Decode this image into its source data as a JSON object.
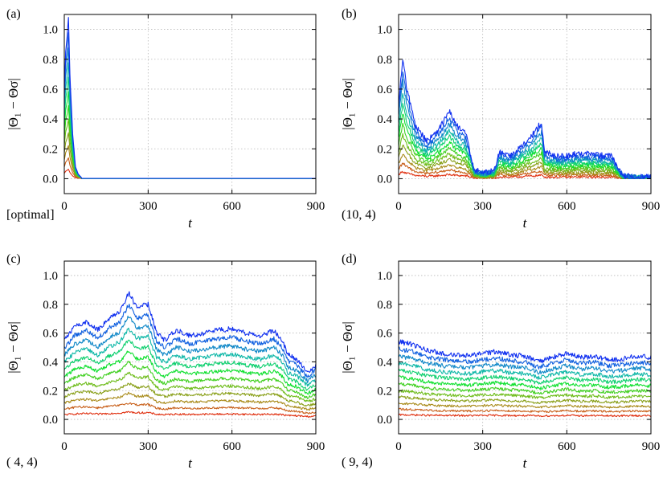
{
  "chart_data": [
    {
      "type": "line",
      "panel_label": "(a)",
      "corner_label": "[optimal]",
      "xlabel": "t",
      "ylabel": "|Θ₁ − Θσ|",
      "xlim": [
        0,
        900
      ],
      "ylim": [
        -0.1,
        1.1
      ],
      "xticks": [
        "0",
        "300",
        "600",
        "900"
      ],
      "yticks": [
        "0.0",
        "0.2",
        "0.4",
        "0.6",
        "0.8",
        "1.0"
      ],
      "grid": true,
      "n_series": 12,
      "series_colors": [
        "#e03010",
        "#c8601a",
        "#a88a18",
        "#8aa01a",
        "#6ebc1a",
        "#40d020",
        "#10e030",
        "#10d070",
        "#10b8a8",
        "#1088c8",
        "#1060e0",
        "#1030f0"
      ],
      "series": [
        {
          "x": [
            0,
            5,
            10,
            15,
            20,
            30,
            40,
            50,
            60,
            80,
            100,
            900
          ],
          "values": [
            0.6,
            0.85,
            0.95,
            1.08,
            0.7,
            0.3,
            0.08,
            0.03,
            0.01,
            0.003,
            0.0,
            0.0
          ]
        }
      ]
    },
    {
      "type": "line",
      "panel_label": "(b)",
      "corner_label": "(10, 4)",
      "xlabel": "t",
      "ylabel": "|Θ₁ − Θσ|",
      "xlim": [
        0,
        900
      ],
      "ylim": [
        -0.1,
        1.1
      ],
      "xticks": [
        "0",
        "300",
        "600",
        "900"
      ],
      "yticks": [
        "0.0",
        "0.2",
        "0.4",
        "0.6",
        "0.8",
        "1.0"
      ],
      "grid": true,
      "n_series": 12,
      "series_colors": [
        "#e03010",
        "#c8601a",
        "#a88a18",
        "#8aa01a",
        "#6ebc1a",
        "#40d020",
        "#10e030",
        "#10d070",
        "#10b8a8",
        "#1088c8",
        "#1060e0",
        "#1030f0"
      ],
      "series": [
        {
          "x": [
            0,
            15,
            30,
            60,
            100,
            130,
            160,
            180,
            210,
            240,
            270,
            300,
            340,
            360,
            400,
            440,
            480,
            510,
            520,
            560,
            600,
            650,
            700,
            760,
            780,
            800,
            850,
            900
          ],
          "values": [
            0.5,
            0.8,
            0.6,
            0.35,
            0.25,
            0.3,
            0.38,
            0.45,
            0.35,
            0.3,
            0.06,
            0.04,
            0.05,
            0.18,
            0.15,
            0.22,
            0.3,
            0.38,
            0.18,
            0.15,
            0.15,
            0.17,
            0.16,
            0.15,
            0.08,
            0.02,
            0.01,
            0.01
          ]
        }
      ]
    },
    {
      "type": "line",
      "panel_label": "(c)",
      "corner_label": "( 4, 4)",
      "xlabel": "t",
      "ylabel": "|Θ₁ − Θσ|",
      "xlim": [
        0,
        900
      ],
      "ylim": [
        -0.1,
        1.1
      ],
      "xticks": [
        "0",
        "300",
        "600",
        "900"
      ],
      "yticks": [
        "0.0",
        "0.2",
        "0.4",
        "0.6",
        "0.8",
        "1.0"
      ],
      "grid": true,
      "n_series": 12,
      "series_colors": [
        "#e03010",
        "#c8601a",
        "#a88a18",
        "#8aa01a",
        "#6ebc1a",
        "#40d020",
        "#10e030",
        "#10d070",
        "#10b8a8",
        "#1088c8",
        "#1060e0",
        "#1030f0"
      ],
      "series": [
        {
          "x": [
            0,
            40,
            80,
            120,
            160,
            200,
            230,
            260,
            300,
            330,
            360,
            400,
            450,
            500,
            550,
            600,
            650,
            700,
            750,
            780,
            800,
            830,
            870,
            900
          ],
          "values": [
            0.55,
            0.65,
            0.68,
            0.62,
            0.7,
            0.75,
            0.88,
            0.78,
            0.8,
            0.6,
            0.55,
            0.62,
            0.58,
            0.6,
            0.62,
            0.63,
            0.6,
            0.58,
            0.62,
            0.55,
            0.45,
            0.42,
            0.33,
            0.38
          ]
        }
      ]
    },
    {
      "type": "line",
      "panel_label": "(d)",
      "corner_label": "( 9, 4)",
      "xlabel": "t",
      "ylabel": "|Θ₁ − Θσ|",
      "xlim": [
        0,
        900
      ],
      "ylim": [
        -0.1,
        1.1
      ],
      "xticks": [
        "0",
        "300",
        "600",
        "900"
      ],
      "yticks": [
        "0.0",
        "0.2",
        "0.4",
        "0.6",
        "0.8",
        "1.0"
      ],
      "grid": true,
      "n_series": 12,
      "series_colors": [
        "#e03010",
        "#c8601a",
        "#a88a18",
        "#8aa01a",
        "#6ebc1a",
        "#40d020",
        "#10e030",
        "#10d070",
        "#10b8a8",
        "#1088c8",
        "#1060e0",
        "#1030f0"
      ],
      "series": [
        {
          "x": [
            0,
            50,
            100,
            150,
            200,
            250,
            300,
            350,
            400,
            450,
            500,
            550,
            600,
            650,
            700,
            750,
            800,
            850,
            900
          ],
          "values": [
            0.54,
            0.52,
            0.48,
            0.46,
            0.45,
            0.44,
            0.46,
            0.47,
            0.45,
            0.44,
            0.4,
            0.43,
            0.46,
            0.43,
            0.44,
            0.41,
            0.42,
            0.44,
            0.43
          ]
        }
      ]
    }
  ]
}
